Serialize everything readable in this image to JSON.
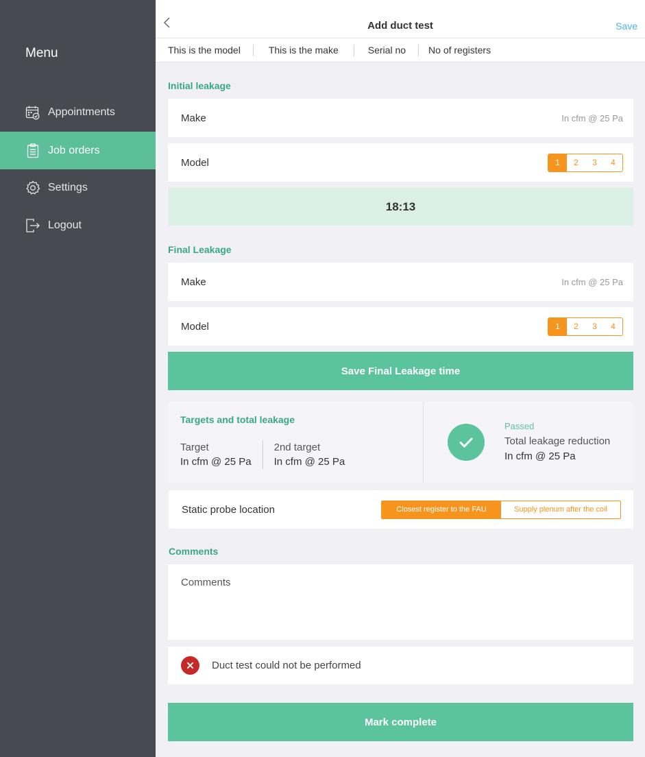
{
  "sidebar": {
    "title": "Menu",
    "items": [
      {
        "label": "Appointments",
        "icon": "calendar-icon"
      },
      {
        "label": "Job orders",
        "icon": "clipboard-icon",
        "active": true
      },
      {
        "label": "Settings",
        "icon": "gear-icon"
      },
      {
        "label": "Logout",
        "icon": "logout-icon"
      }
    ]
  },
  "header": {
    "title": "Add duct test",
    "save_label": "Save",
    "back_icon": "chevron-left-icon"
  },
  "subheader": {
    "model": "This is the model",
    "make": "This is  the make",
    "serial": "Serial no",
    "registers": "No of registers"
  },
  "initial": {
    "section_label": "Initial leakage",
    "make_label": "Make",
    "make_hint": "In cfm @ 25 Pa",
    "model_label": "Model",
    "options": [
      "1",
      "2",
      "3",
      "4"
    ],
    "selected": "1",
    "timer": "18:13"
  },
  "final": {
    "section_label": "Final Leakage",
    "make_label": "Make",
    "make_hint": "In cfm @ 25 Pa",
    "model_label": "Model",
    "options": [
      "1",
      "2",
      "3",
      "4"
    ],
    "selected": "1",
    "save_button": "Save Final Leakage time"
  },
  "targets": {
    "title": "Targets and total leakage",
    "target_label": "Target",
    "target_value": "In cfm @ 25 Pa",
    "second_label": "2nd target",
    "second_value": "In cfm @ 25 Pa",
    "status": "Passed",
    "reduction_label": "Total leakage reduction",
    "reduction_value": "In cfm @ 25 Pa"
  },
  "probe": {
    "label": "Static probe location",
    "options": [
      "Closest register to the FAU",
      "Supply plenum after the coil"
    ],
    "selected": "Closest register to the FAU"
  },
  "comments": {
    "section_label": "Comments",
    "placeholder": "Comments"
  },
  "fail": {
    "label": "Duct test could not be performed"
  },
  "complete_button": "Mark complete",
  "colors": {
    "accent_green": "#5bc49f",
    "accent_orange": "#f7941d",
    "sidebar_bg": "#474a50",
    "error_red": "#c62828",
    "link_blue": "#4ab4f0"
  }
}
